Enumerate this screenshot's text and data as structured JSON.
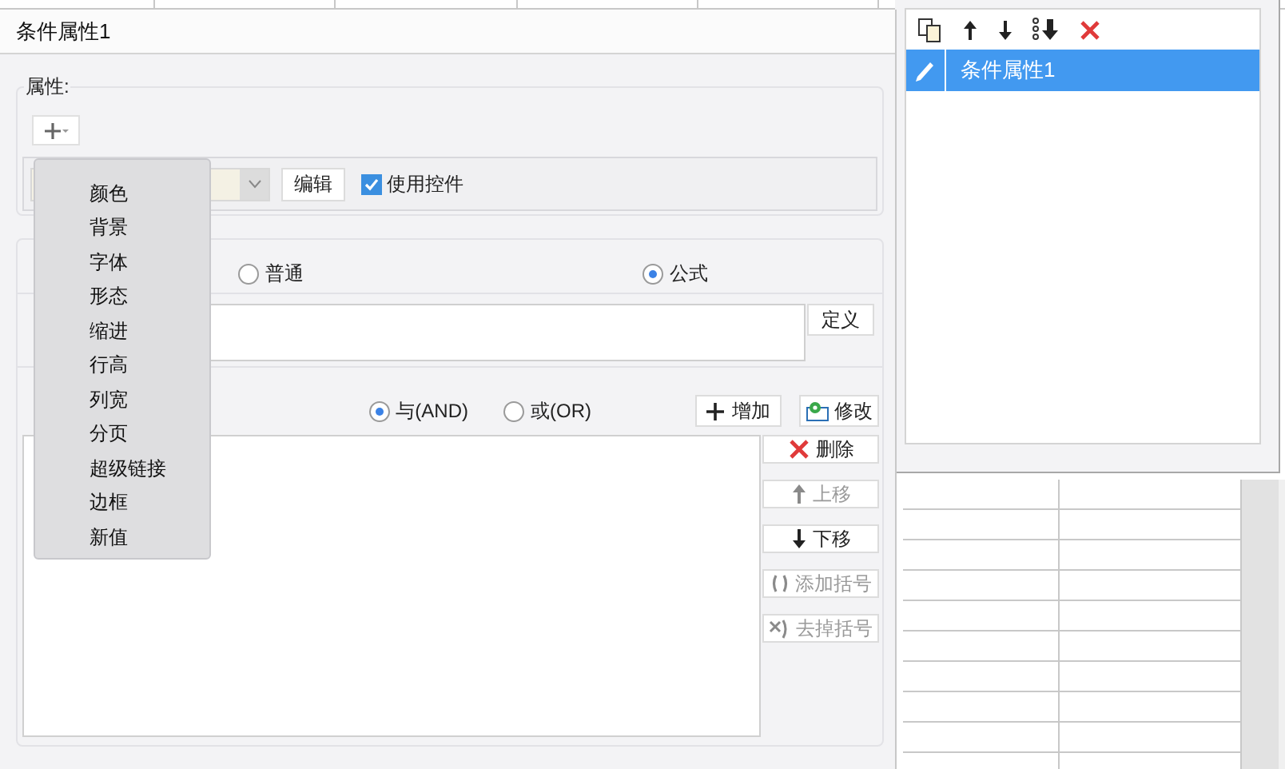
{
  "dialog": {
    "title": "条件属性1"
  },
  "properties_group": {
    "legend": "属性:",
    "edit_button": "编辑",
    "use_control": {
      "label": "使用控件",
      "checked": true
    }
  },
  "menu": {
    "items": [
      "颜色",
      "背景",
      "字体",
      "形态",
      "缩进",
      "行高",
      "列宽",
      "分页",
      "超级链接",
      "边框",
      "新值"
    ]
  },
  "condition_group": {
    "type_options": [
      {
        "label": "普通",
        "selected": false
      },
      {
        "label": "公式",
        "selected": true
      }
    ],
    "define_button": "定义",
    "logic_options": [
      {
        "label": "与(AND)",
        "selected": true
      },
      {
        "label": "或(OR)",
        "selected": false
      }
    ],
    "add_button": "增加",
    "modify_button": "修改",
    "side_buttons": [
      {
        "kind": "delete",
        "label": "删除",
        "disabled": false
      },
      {
        "kind": "up",
        "label": "上移",
        "disabled": true
      },
      {
        "kind": "down",
        "label": "下移",
        "disabled": false
      },
      {
        "kind": "add-bracket",
        "label": "添加括号",
        "disabled": true
      },
      {
        "kind": "remove-bracket",
        "label": "去掉括号",
        "disabled": true
      }
    ]
  },
  "right_panel": {
    "items": [
      {
        "label": "条件属性1",
        "selected": true
      }
    ]
  }
}
